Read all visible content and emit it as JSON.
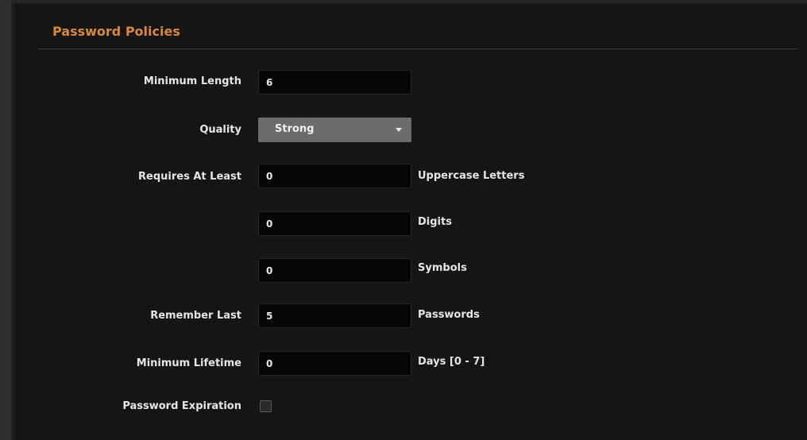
{
  "section": {
    "title": "Password Policies"
  },
  "fields": {
    "minimum_length": {
      "label": "Minimum Length",
      "value": "6"
    },
    "quality": {
      "label": "Quality",
      "selected": "Strong"
    },
    "requires_at_least": {
      "label": "Requires At Least",
      "uppercase": {
        "value": "0",
        "suffix": "Uppercase Letters"
      },
      "digits": {
        "value": "0",
        "suffix": "Digits"
      },
      "symbols": {
        "value": "0",
        "suffix": "Symbols"
      }
    },
    "remember_last": {
      "label": "Remember Last",
      "value": "5",
      "suffix": "Passwords"
    },
    "minimum_lifetime": {
      "label": "Minimum Lifetime",
      "value": "0",
      "suffix": "Days [0 - 7]"
    },
    "password_expiration": {
      "label": "Password Expiration",
      "checked": false
    }
  },
  "colors": {
    "accent": "#d8883a",
    "background": "#151515",
    "field_background": "#060606",
    "select_background": "#6c6c6c"
  }
}
